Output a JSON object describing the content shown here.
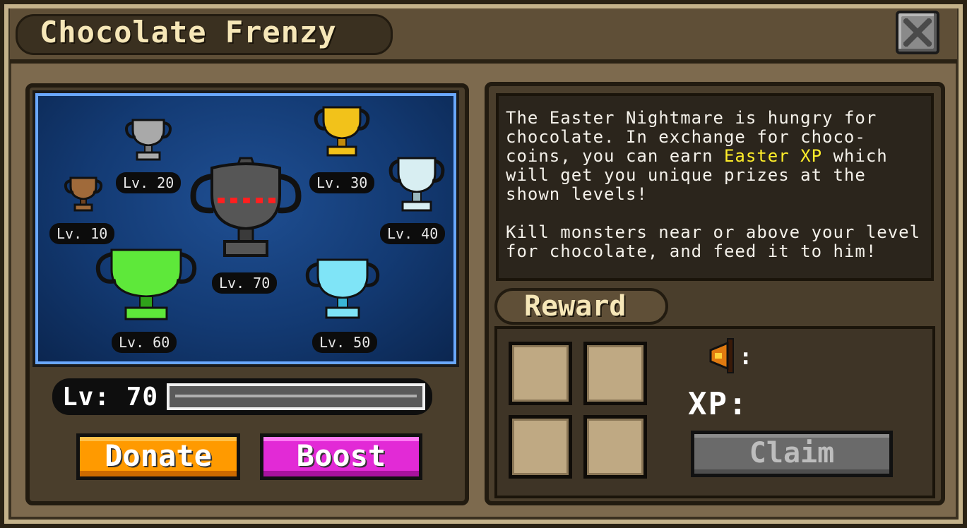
{
  "window": {
    "title": "Chocolate Frenzy"
  },
  "trophies": [
    {
      "label": "Lv. 10",
      "tier": "bronze"
    },
    {
      "label": "Lv. 20",
      "tier": "silver"
    },
    {
      "label": "Lv. 30",
      "tier": "gold"
    },
    {
      "label": "Lv. 40",
      "tier": "platinum"
    },
    {
      "label": "Lv. 50",
      "tier": "diamond"
    },
    {
      "label": "Lv. 60",
      "tier": "emerald"
    },
    {
      "label": "Lv. 70",
      "tier": "nightmare"
    }
  ],
  "level": {
    "text": "Lv: 70",
    "progress": 0.0
  },
  "buttons": {
    "donate": "Donate",
    "boost": "Boost",
    "claim": "Claim"
  },
  "description": {
    "line1_pre": "The Easter Nightmare is hungry for chocolate. In exchange for choco-coins, you can earn ",
    "highlight": "Easter XP",
    "line1_post": " which will get you unique prizes at the shown levels!",
    "paragraph2": "Kill monsters near or above your level for chocolate, and feed it to him!"
  },
  "reward": {
    "heading": "Reward",
    "coin_suffix": ":",
    "xp_label": "XP:",
    "slots": [
      "",
      "",
      "",
      ""
    ]
  },
  "colors": {
    "highlight": "#ffee2a",
    "donate": "#ff9a00",
    "boost": "#e22ad6"
  },
  "icons": {
    "close": "close-x-icon",
    "coin": "chocolate-coin-icon"
  }
}
